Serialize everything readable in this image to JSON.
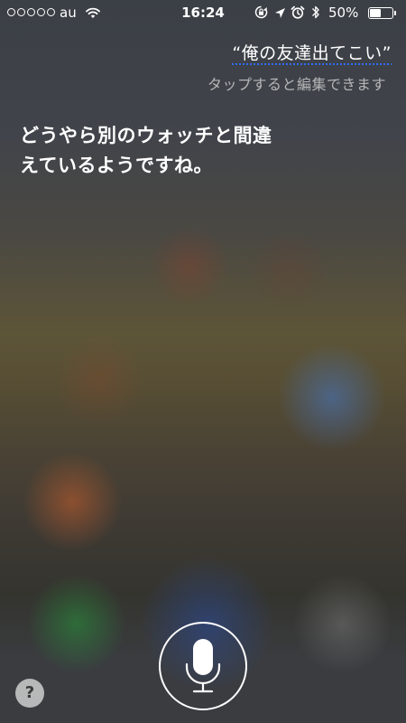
{
  "status_bar": {
    "signal_dots": 5,
    "carrier": "au",
    "time": "16:24",
    "battery_percent": "50%",
    "battery_level": 0.5,
    "icons": [
      "wifi-icon",
      "rotation-lock-icon",
      "location-icon",
      "alarm-icon",
      "bluetooth-icon",
      "battery-icon"
    ]
  },
  "siri": {
    "user_query": "“俺の友達出てこい”",
    "tap_to_edit_hint": "タップすると編集できます",
    "response_lines": [
      "どうやら別のウォッチと間違",
      "えているようですね。"
    ]
  },
  "controls": {
    "help_label": "?",
    "mic_icon": "microphone-icon"
  },
  "colors": {
    "text": "#ffffff",
    "hint_text": "#d8d8d8",
    "query_underline": "#2f6bff"
  }
}
